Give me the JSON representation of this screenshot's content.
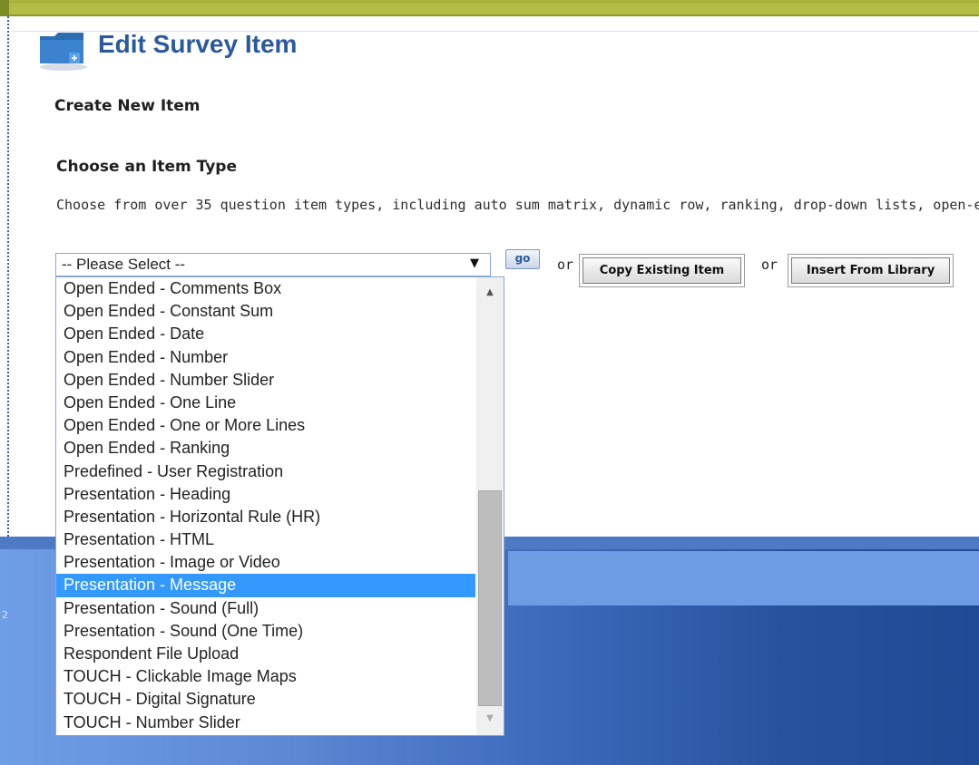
{
  "header": {
    "title": "Edit Survey Item"
  },
  "section": {
    "create_title": "Create New Item",
    "choose_title": "Choose an Item Type",
    "description": "Choose from over 35 question item types, including auto sum matrix, dynamic row, ranking, drop-down lists, open-en"
  },
  "item_type_select": {
    "value": "-- Please Select --",
    "arrow": "▼",
    "options": [
      "Open Ended - Comments Box",
      "Open Ended - Constant Sum",
      "Open Ended - Date",
      "Open Ended - Number",
      "Open Ended - Number Slider",
      "Open Ended - One Line",
      "Open Ended - One or More Lines",
      "Open Ended - Ranking",
      "Predefined - User Registration",
      "Presentation - Heading",
      "Presentation - Horizontal Rule (HR)",
      "Presentation - HTML",
      "Presentation - Image or Video",
      "Presentation - Message",
      "Presentation - Sound (Full)",
      "Presentation - Sound (One Time)",
      "Respondent File Upload",
      "TOUCH - Clickable Image Maps",
      "TOUCH - Digital Signature",
      "TOUCH - Number Slider"
    ],
    "highlighted_option": "Presentation - Message"
  },
  "actions": {
    "go_label": "go",
    "or_label_1": "or",
    "or_label_2": "or",
    "copy_label": "Copy Existing Item",
    "insert_label": "Insert From Library"
  },
  "scroll": {
    "up_glyph": "▲",
    "down_glyph": "▼"
  },
  "footer": {
    "fragment": "2"
  },
  "colors": {
    "title": "#2a5a9e",
    "top_bar": "#b3bd45",
    "highlight": "#3399ff",
    "footer_band": "#3f6bbd"
  },
  "icons": {
    "folder": "folder-add-icon",
    "dropdown_arrow": "chevron-down-icon"
  }
}
